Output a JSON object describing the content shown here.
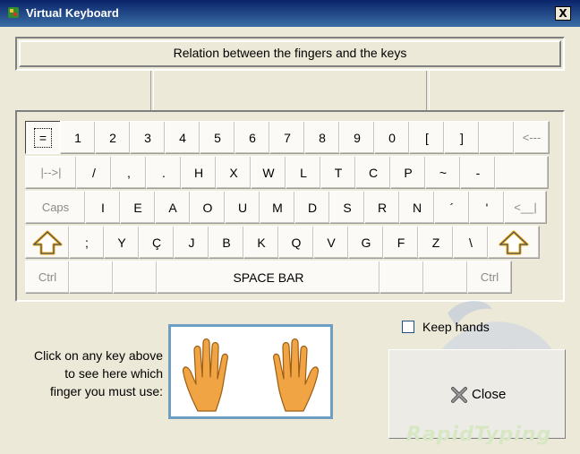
{
  "window": {
    "title": "Virtual Keyboard",
    "close_glyph": "X"
  },
  "relation_label": "Relation between the fingers and the keys",
  "keyboard": {
    "rows": [
      [
        "=",
        "1",
        "2",
        "3",
        "4",
        "5",
        "6",
        "7",
        "8",
        "9",
        "0",
        "[",
        "]",
        "",
        "<---"
      ],
      [
        "|-->|",
        "/",
        ",",
        ".",
        "H",
        "X",
        "W",
        "L",
        "T",
        "C",
        "P",
        "~",
        "-",
        ""
      ],
      [
        "Caps",
        "I",
        "E",
        "A",
        "O",
        "U",
        "M",
        "D",
        "S",
        "R",
        "N",
        "´",
        "'",
        "<__|"
      ],
      [
        "shift",
        ";",
        "Y",
        "Ç",
        "J",
        "B",
        "K",
        "Q",
        "V",
        "G",
        "F",
        "Z",
        "\\",
        "shift"
      ],
      [
        "Ctrl",
        "",
        "",
        "SPACE BAR",
        "",
        "",
        "Ctrl"
      ]
    ]
  },
  "instructions": [
    "Click on any key above",
    "to see here which",
    "finger you must use:"
  ],
  "keep_hands": {
    "label": "Keep hands",
    "checked": false
  },
  "close_button": {
    "label": "Close"
  },
  "brand": "RapidTyping",
  "colors": {
    "hand": "#f0a444",
    "hand_outline": "#9c5d14",
    "frame": "#6e9ec2",
    "shift_arrow": "#f5a500"
  }
}
